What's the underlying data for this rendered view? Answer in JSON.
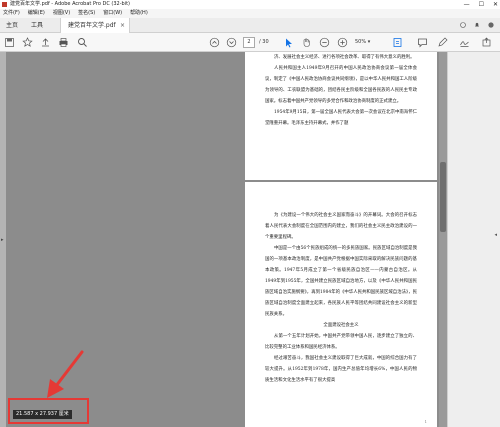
{
  "window": {
    "title": "建党百年文学.pdf - Adobe Acrobat Pro DC (32-bit)",
    "controls": [
      "—",
      "☐",
      "✕"
    ]
  },
  "menu": [
    "文件(F)",
    "编辑(E)",
    "视图(V)",
    "签名(S)",
    "窗口(W)",
    "帮助(H)"
  ],
  "tabs": {
    "home": "主页",
    "tools": "工具",
    "document": "建党百年文学.pdf",
    "close": "×"
  },
  "toolbar": {
    "icons": [
      "save-icon",
      "bookmark-star-icon",
      "upload-icon",
      "print-icon",
      "find-icon",
      "prev-page-icon",
      "next-page-icon",
      "select-cursor-icon",
      "hand-icon",
      "zoom-out-icon",
      "zoom-in-icon",
      "fit-page-icon",
      "comment-icon",
      "highlight-pen-icon",
      "sign-icon",
      "share-icon"
    ],
    "page_current": "2",
    "page_total": "/ 30",
    "zoom": "50%"
  },
  "page1": {
    "paragraphs": [
      "济、发展社会主义经济、进行各项社会改革、取得了有伟大意义的胜利。",
      "人民共和国主人1949年9月召开的中国人民政治协商会议第一届全体会议，制定了《中国人民政治协商会议共同纲领》，是以中华人民共和国工人阶级为领导的、工农联盟为基础的，团结各民主阶级和全国各民族的人民民主专政国家。标志着中国共产党领导的多党合作和政治协商制度的正式建立。",
      "1954年9月15日，第一届全国人民代表大会第一次会议在北京中南海怀仁堂隆重开幕。毛泽东主持开幕式，并作了题"
    ]
  },
  "page2": {
    "paragraphs": [
      "为《为建设一个伟大的社会主义国家而奋斗》的开幕词。大会的召开标志着人民代表大会制度在全国范围内的建立，我们的社会主义民主政治建设的一个重要里程碑。",
      "中国是一个由56个民族组成的统一的多民族国家。民族区域自治制度是我国的一项基本政治制度，是中国共产党根据中国实际采取的解决民族问题的基本政策。1947年5月成立了第一个省级民族自治区——内蒙古自治区。从1949年到1955年，全国共建立民族区域自治地方，以及《中华人民共和国民族区域自治实施纲要》，再到1984年的《中华人民共和国民族区域自治法》，民族区域自治制度全面建立起来，各民族人民平等团结共同建设社会主义的新型民族关系。",
      "全面建设社会主义",
      "从第一个五年计划开始，中国共产党带领中国人民，逐步建立了独立的、比较完整的工业体系和国民经济体系。",
      "经过艰苦奋斗，我国社会主义建设取得了巨大成就，中国的综合国力有了较大提升。从1952年到1978年，国内生产总值年均增长6%，中国人民的物质生活和文化生活水平有了很大提高"
    ],
    "page_number": "1"
  },
  "status": {
    "dimensions": "21.587 x 27.937 厘米"
  },
  "colors": {
    "highlight_red": "#e53935",
    "toolbar_blue": "#1473e6",
    "canvas_gray": "#8c8c8c"
  }
}
